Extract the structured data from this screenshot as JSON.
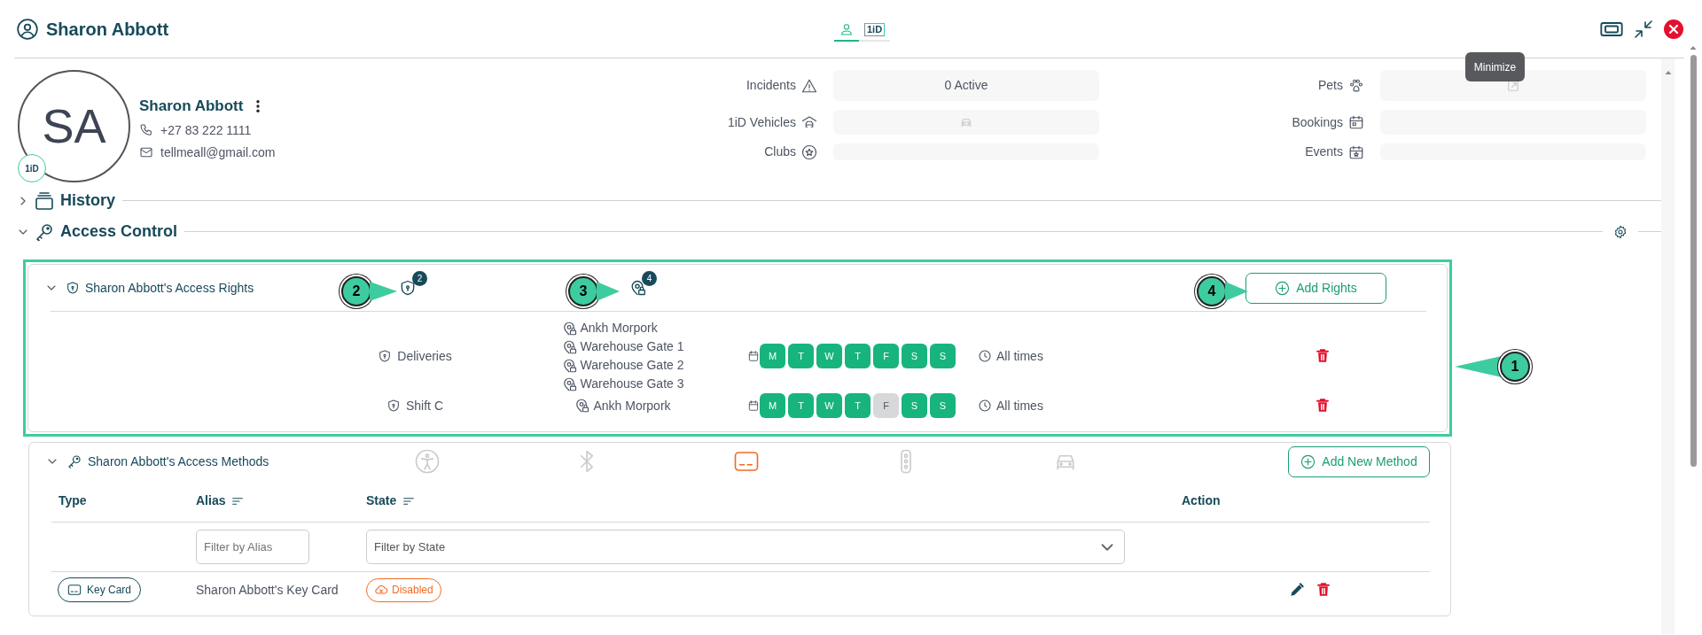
{
  "header": {
    "title": "Sharon Abbott",
    "tabs": [
      {
        "kind": "person",
        "selected": true
      },
      {
        "kind": "oneid",
        "label": "1iD",
        "selected": false
      }
    ],
    "tooltip": "Minimize"
  },
  "profile": {
    "initials": "SA",
    "badge": "1iD",
    "name": "Sharon Abbott",
    "phone": "+27 83 222 1111",
    "email": "tellmeall@gmail.com"
  },
  "stats": [
    {
      "kind": "incidents",
      "label": "Incidents",
      "value": "0 Active"
    },
    {
      "kind": "pets",
      "label": "Pets"
    },
    {
      "kind": "vehicles",
      "label": "1iD Vehicles"
    },
    {
      "kind": "bookings",
      "label": "Bookings"
    },
    {
      "kind": "clubs",
      "label": "Clubs"
    },
    {
      "kind": "events",
      "label": "Events"
    }
  ],
  "sections": [
    {
      "kind": "history",
      "title": "History",
      "expanded": false
    },
    {
      "kind": "access",
      "title": "Access Control",
      "expanded": true
    }
  ],
  "access_rights": {
    "title": "Sharon Abbott's Access Rights",
    "expanded": true,
    "rights_count": "2",
    "locations_count": "4",
    "button": "Add Rights",
    "rows": [
      {
        "name": "Deliveries",
        "locations": [
          "Ankh Morpork",
          "Warehouse Gate 1",
          "Warehouse Gate 2",
          "Warehouse Gate 3"
        ],
        "days": [
          {
            "label": "M",
            "on": true
          },
          {
            "label": "T",
            "on": true
          },
          {
            "label": "W",
            "on": true
          },
          {
            "label": "T",
            "on": true
          },
          {
            "label": "F",
            "on": true
          },
          {
            "label": "S",
            "on": true
          },
          {
            "label": "S",
            "on": true
          }
        ],
        "time": "All times"
      },
      {
        "name": "Shift C",
        "locations": [
          "Ankh Morpork"
        ],
        "days": [
          {
            "label": "M",
            "on": true
          },
          {
            "label": "T",
            "on": true
          },
          {
            "label": "W",
            "on": true
          },
          {
            "label": "T",
            "on": true
          },
          {
            "label": "F",
            "on": false
          },
          {
            "label": "S",
            "on": true
          },
          {
            "label": "S",
            "on": true
          }
        ],
        "time": "All times"
      }
    ]
  },
  "access_methods": {
    "title": "Sharon Abbott's Access Methods",
    "expanded": true,
    "button": "Add New Method",
    "methods": [
      {
        "kind": "accessibility",
        "selected": false
      },
      {
        "kind": "bluetooth",
        "selected": false
      },
      {
        "kind": "card",
        "selected": true
      },
      {
        "kind": "remote",
        "selected": false
      },
      {
        "kind": "car",
        "selected": false
      }
    ],
    "columns": [
      {
        "label": "Type",
        "sortable": false
      },
      {
        "label": "Alias",
        "sortable": true
      },
      {
        "label": "State",
        "sortable": true
      },
      {
        "label": "Action",
        "sortable": false
      }
    ],
    "filters": {
      "alias_placeholder": "Filter by Alias",
      "state_placeholder": "Filter by State"
    },
    "rows": [
      {
        "type": "Key Card",
        "alias": "Sharon Abbott's Key Card",
        "state": "Disabled"
      }
    ]
  },
  "callouts": [
    {
      "label": "1",
      "kind": "left"
    },
    {
      "label": "2",
      "kind": "right"
    },
    {
      "label": "3",
      "kind": "right"
    },
    {
      "label": "4",
      "kind": "right"
    }
  ]
}
